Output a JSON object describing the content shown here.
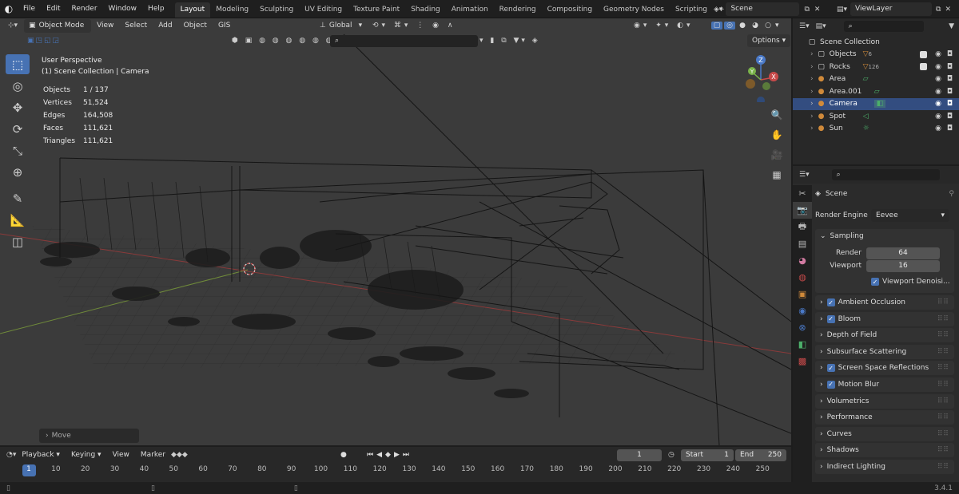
{
  "topbar": {
    "menus": [
      "File",
      "Edit",
      "Render",
      "Window",
      "Help"
    ],
    "workspaces": [
      "Layout",
      "Modeling",
      "Sculpting",
      "UV Editing",
      "Texture Paint",
      "Shading",
      "Animation",
      "Rendering",
      "Compositing",
      "Geometry Nodes",
      "Scripting"
    ],
    "active_workspace": "Layout",
    "add_tab": "+",
    "scene": "Scene",
    "view_layer": "ViewLayer"
  },
  "viewport_header": {
    "mode": "Object Mode",
    "menus": [
      "View",
      "Select",
      "Add",
      "Object",
      "GIS"
    ],
    "orientation": "Global",
    "options": "Options"
  },
  "viewport": {
    "perspective": "User Perspective",
    "collection": "(1) Scene Collection | Camera",
    "stats": [
      {
        "label": "Objects",
        "value": "1 / 137"
      },
      {
        "label": "Vertices",
        "value": "51,524"
      },
      {
        "label": "Edges",
        "value": "164,508"
      },
      {
        "label": "Faces",
        "value": "111,621"
      },
      {
        "label": "Triangles",
        "value": "111,621"
      }
    ],
    "last_op": "Move",
    "gizmo": {
      "z": "Z",
      "y": "Y",
      "x": "X"
    }
  },
  "outliner": {
    "root": "Scene Collection",
    "items": [
      {
        "name": "Objects",
        "badge": "6"
      },
      {
        "name": "Rocks",
        "badge": "126"
      },
      {
        "name": "Area",
        "badge": ""
      },
      {
        "name": "Area.001",
        "badge": ""
      },
      {
        "name": "Camera",
        "badge": ""
      },
      {
        "name": "Spot",
        "badge": ""
      },
      {
        "name": "Sun",
        "badge": ""
      }
    ],
    "selected": "Camera"
  },
  "properties": {
    "context": "Scene",
    "render_engine_label": "Render Engine",
    "render_engine": "Eevee",
    "sampling": {
      "title": "Sampling",
      "render_label": "Render",
      "render": "64",
      "viewport_label": "Viewport",
      "viewport": "16",
      "denoise": "Viewport Denoisi..."
    },
    "panels": [
      {
        "label": "Ambient Occlusion",
        "checkbox": true
      },
      {
        "label": "Bloom",
        "checkbox": true
      },
      {
        "label": "Depth of Field",
        "checkbox": false
      },
      {
        "label": "Subsurface Scattering",
        "checkbox": false
      },
      {
        "label": "Screen Space Reflections",
        "checkbox": true
      },
      {
        "label": "Motion Blur",
        "checkbox": true
      },
      {
        "label": "Volumetrics",
        "checkbox": false
      },
      {
        "label": "Performance",
        "checkbox": false
      },
      {
        "label": "Curves",
        "checkbox": false
      },
      {
        "label": "Shadows",
        "checkbox": false
      },
      {
        "label": "Indirect Lighting",
        "checkbox": false
      }
    ]
  },
  "timeline": {
    "menus": [
      "Playback",
      "Keying",
      "View",
      "Marker"
    ],
    "current_frame": "1",
    "start_label": "Start",
    "start": "1",
    "end_label": "End",
    "end": "250",
    "ruler": [
      "1",
      "10",
      "20",
      "30",
      "40",
      "50",
      "60",
      "70",
      "80",
      "90",
      "100",
      "110",
      "120",
      "130",
      "140",
      "150",
      "160",
      "170",
      "180",
      "190",
      "200",
      "210",
      "220",
      "230",
      "240",
      "250"
    ]
  },
  "status": {
    "version": "3.4.1"
  },
  "colors": {
    "accent": "#4772b3",
    "selected_row": "#334d80",
    "viewport_bg": "#3b3b3b"
  }
}
